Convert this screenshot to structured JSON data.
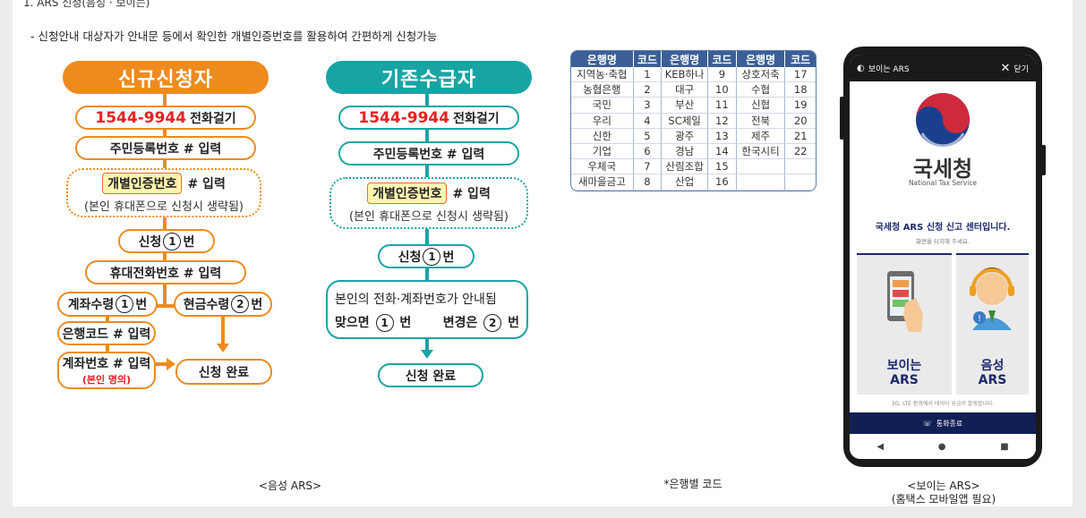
{
  "header": {
    "cut_title": "1. ARS 신청(음성 · 보이는)",
    "subtitle": "- 신청안내 대상자가 안내문 등에서 확인한 개별인증번호를 활용하여 간편하게 신청가능"
  },
  "new_flow": {
    "title": "신규신청자",
    "phone": "1544-9944",
    "call": "전화걸기",
    "resident": "주민등록번호 # 입력",
    "auth_code": "개별인증번호",
    "auth_input": "# 입력",
    "auth_note": "(본인 휴대폰으로 신청시 생략됨)",
    "apply_a": "신청",
    "apply_num": "1",
    "apply_b": "번",
    "mobile": "휴대전화번호 # 입력",
    "account_a": "계좌수령",
    "account_num": "1",
    "account_b": "번",
    "cash_a": "현금수령",
    "cash_num": "2",
    "cash_b": "번",
    "bank_code": "은행코드 # 입력",
    "account_no": "계좌번호 # 입력",
    "own_name": "(본인 명의)",
    "done": "신청 완료"
  },
  "existing_flow": {
    "title": "기존수급자",
    "phone": "1544-9944",
    "call": "전화걸기",
    "resident": "주민등록번호 # 입력",
    "auth_code": "개별인증번호",
    "auth_input": "# 입력",
    "auth_note": "(본인 휴대폰으로 신청시 생략됨)",
    "apply_a": "신청",
    "apply_num": "1",
    "apply_b": "번",
    "guide": "본인의 전화·계좌번호가 안내됨",
    "correct_a": "맞으면",
    "correct_num": "1",
    "correct_b": "번",
    "change_a": "변경은",
    "change_num": "2",
    "change_b": "번",
    "done": "신청 완료"
  },
  "bank_table": {
    "headers": [
      "은행명",
      "코드",
      "은행명",
      "코드",
      "은행명",
      "코드"
    ],
    "rows": [
      [
        "지역농·축협",
        "1",
        "KEB하나",
        "9",
        "상호저축",
        "17"
      ],
      [
        "농협은행",
        "2",
        "대구",
        "10",
        "수협",
        "18"
      ],
      [
        "국민",
        "3",
        "부산",
        "11",
        "신협",
        "19"
      ],
      [
        "우리",
        "4",
        "SC제일",
        "12",
        "전북",
        "20"
      ],
      [
        "신한",
        "5",
        "광주",
        "13",
        "제주",
        "21"
      ],
      [
        "기업",
        "6",
        "경남",
        "14",
        "한국시티",
        "22"
      ],
      [
        "우체국",
        "7",
        "산림조합",
        "15",
        "",
        ""
      ],
      [
        "새마을금고",
        "8",
        "산업",
        "16",
        "",
        ""
      ]
    ]
  },
  "phone": {
    "topbar_title": "보이는 ARS",
    "close_label": "닫기",
    "org_name_ko": "국세청",
    "org_name_en": "National Tax Service",
    "center_title": "국세청 ARS 신청 신고 센터입니다.",
    "center_sub": "화면을 터치해 주세요.",
    "visible_ars": "보이는\nARS",
    "voice_ars": "음성\nARS",
    "notice": "3G, LTE 환경에서 데이터 요금이 발생합니다.",
    "end_call": "통화종료",
    "nav_back": "◀",
    "nav_home": "●",
    "nav_recent": "■"
  },
  "captions": {
    "voice": "<음성 ARS>",
    "bank": "*은행별 코드",
    "visible": "<보이는 ARS>",
    "visible_note": "(홈택스 모바일앱 필요)"
  },
  "colors": {
    "orange": "#ee8b1f",
    "teal": "#19a4a4",
    "phone_red": "#e52222",
    "navy": "#1b2a6b",
    "table_header": "#3b5f96"
  }
}
